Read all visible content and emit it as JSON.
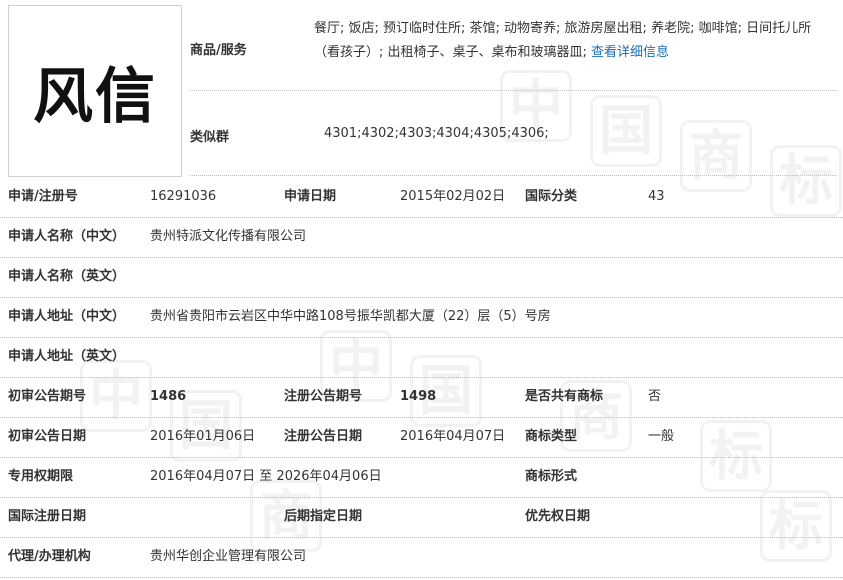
{
  "watermark_chars": [
    "中",
    "国",
    "商",
    "标",
    "中",
    "国",
    "商",
    "标",
    "中",
    "国",
    "商",
    "标"
  ],
  "logo": {
    "text": "风信"
  },
  "goods": {
    "label": "商品/服务",
    "text": "餐厅; 饭店; 预订临时住所; 茶馆; 动物寄养; 旅游房屋出租; 养老院; 咖啡馆; 日间托儿所（看孩子）; 出租椅子、桌子、桌布和玻璃器皿; ",
    "link": "查看详细信息"
  },
  "similar": {
    "label": "类似群",
    "value": "4301;4302;4303;4304;4305;4306;"
  },
  "fields": {
    "reg_no_label": "申请/注册号",
    "reg_no": "16291036",
    "apply_date_label": "申请日期",
    "apply_date": "2015年02月02日",
    "intl_class_label": "国际分类",
    "intl_class": "43",
    "applicant_cn_label": "申请人名称（中文）",
    "applicant_cn": "贵州特派文化传播有限公司",
    "applicant_en_label": "申请人名称（英文）",
    "applicant_en": "",
    "address_cn_label": "申请人地址（中文）",
    "address_cn": "贵州省贵阳市云岩区中华中路108号振华凯都大厦（22）层（5）号房",
    "address_en_label": "申请人地址（英文）",
    "address_en": "",
    "prelim_issue_label": "初审公告期号",
    "prelim_issue": "1486",
    "reg_issue_label": "注册公告期号",
    "reg_issue": "1498",
    "shared_label": "是否共有商标",
    "shared": "否",
    "prelim_date_label": "初审公告日期",
    "prelim_date": "2016年01月06日",
    "reg_date_label": "注册公告日期",
    "reg_date": "2016年04月07日",
    "mark_type_label": "商标类型",
    "mark_type": "一般",
    "exclusive_label": "专用权期限",
    "exclusive": "2016年04月07日 至 2026年04月06日",
    "mark_form_label": "商标形式",
    "mark_form": "",
    "intl_reg_date_label": "国际注册日期",
    "intl_reg_date": "",
    "later_date_label": "后期指定日期",
    "later_date": "",
    "priority_date_label": "优先权日期",
    "priority_date": "",
    "agent_label": "代理/办理机构",
    "agent": "贵州华创企业管理有限公司"
  }
}
